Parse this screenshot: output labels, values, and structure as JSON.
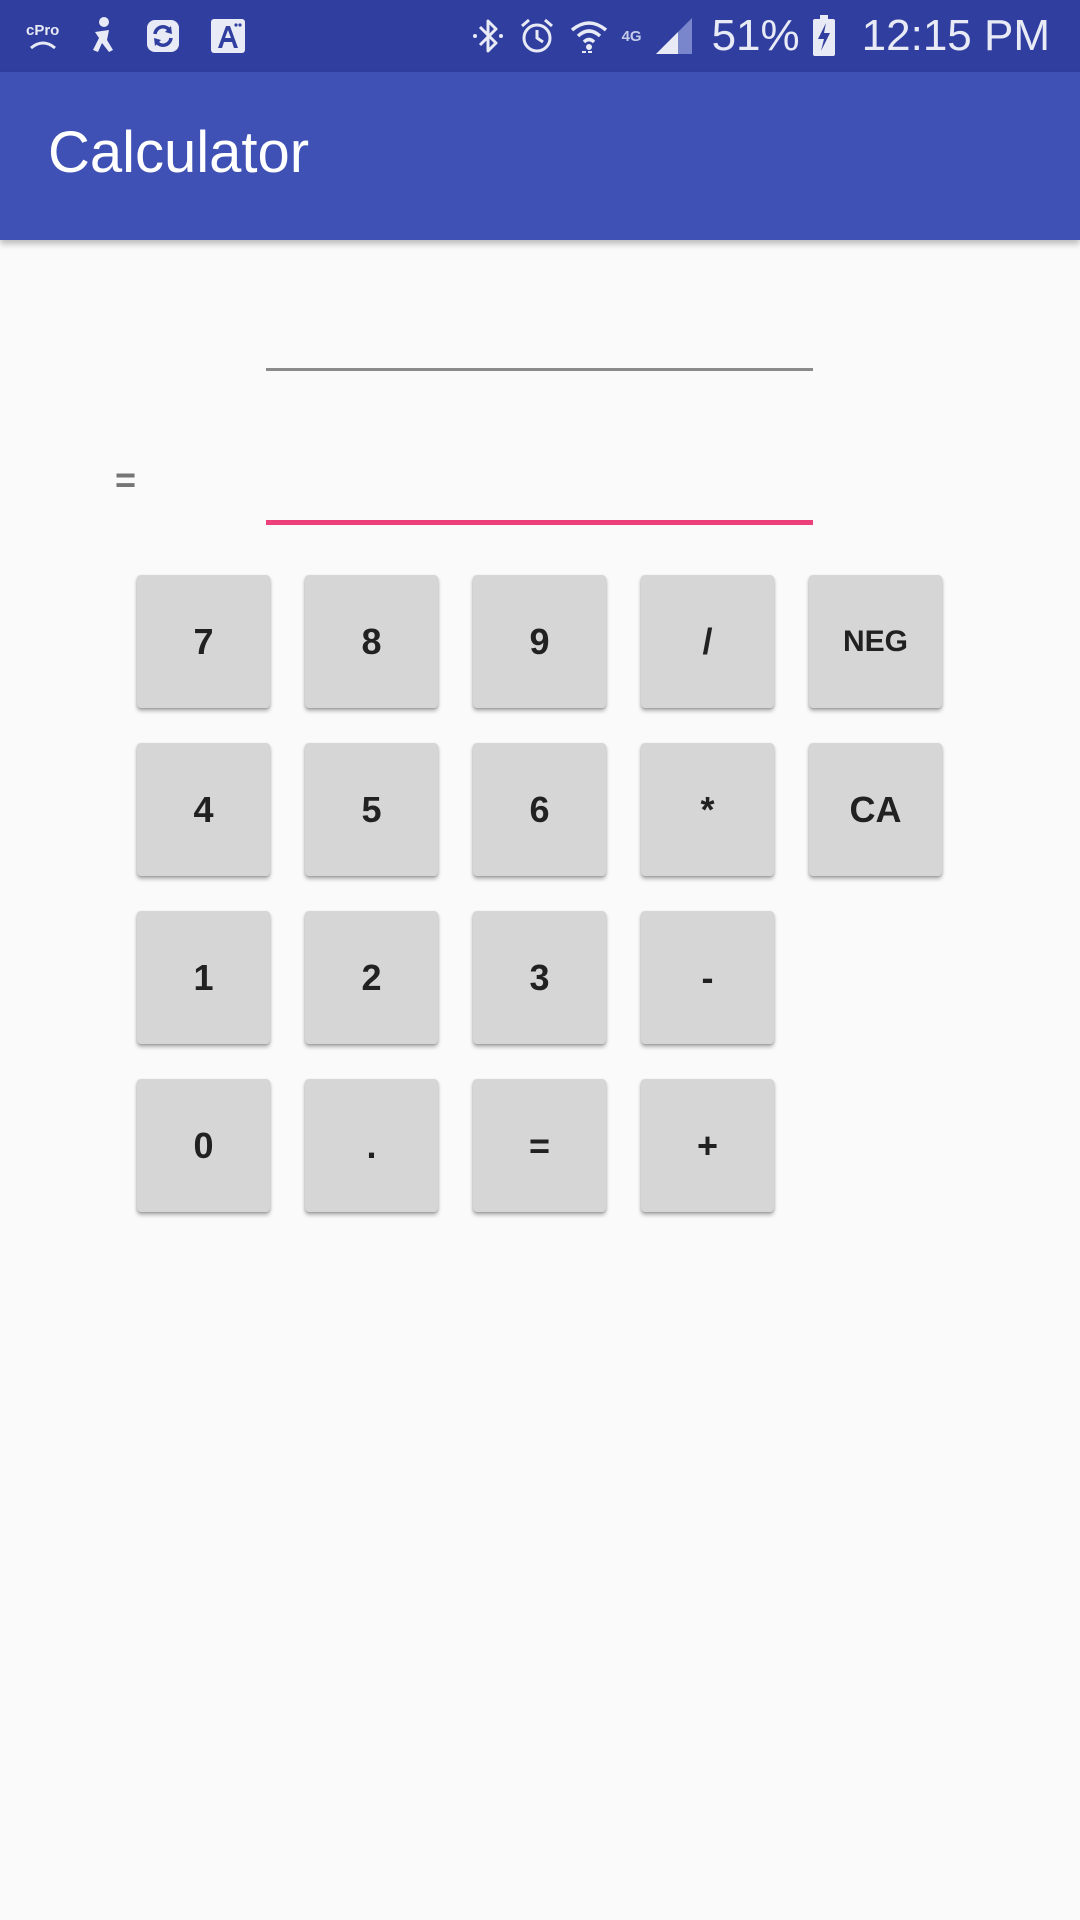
{
  "status_bar": {
    "left_icons": [
      "cpro-icon",
      "accessibility-icon",
      "sync-icon",
      "font-icon"
    ],
    "cpro_text": "cPro",
    "right_icons": [
      "bluetooth-icon",
      "alarm-icon",
      "wifi-icon",
      "lte-icon",
      "signal-icon",
      "battery-charging-icon"
    ],
    "network_label": "4G",
    "battery_percent": "51%",
    "time": "12:15 PM"
  },
  "app_bar": {
    "title": "Calculator",
    "color": "#3f51b5",
    "status_color": "#303f9f"
  },
  "display": {
    "expression_value": "",
    "result_label": "=",
    "result_value": "",
    "accent_color": "#ec407a"
  },
  "keypad": {
    "rows": [
      [
        "7",
        "8",
        "9",
        "/",
        "NEG"
      ],
      [
        "4",
        "5",
        "6",
        "*",
        "CA"
      ],
      [
        "1",
        "2",
        "3",
        "-"
      ],
      [
        "0",
        ".",
        "=",
        "+"
      ]
    ]
  }
}
